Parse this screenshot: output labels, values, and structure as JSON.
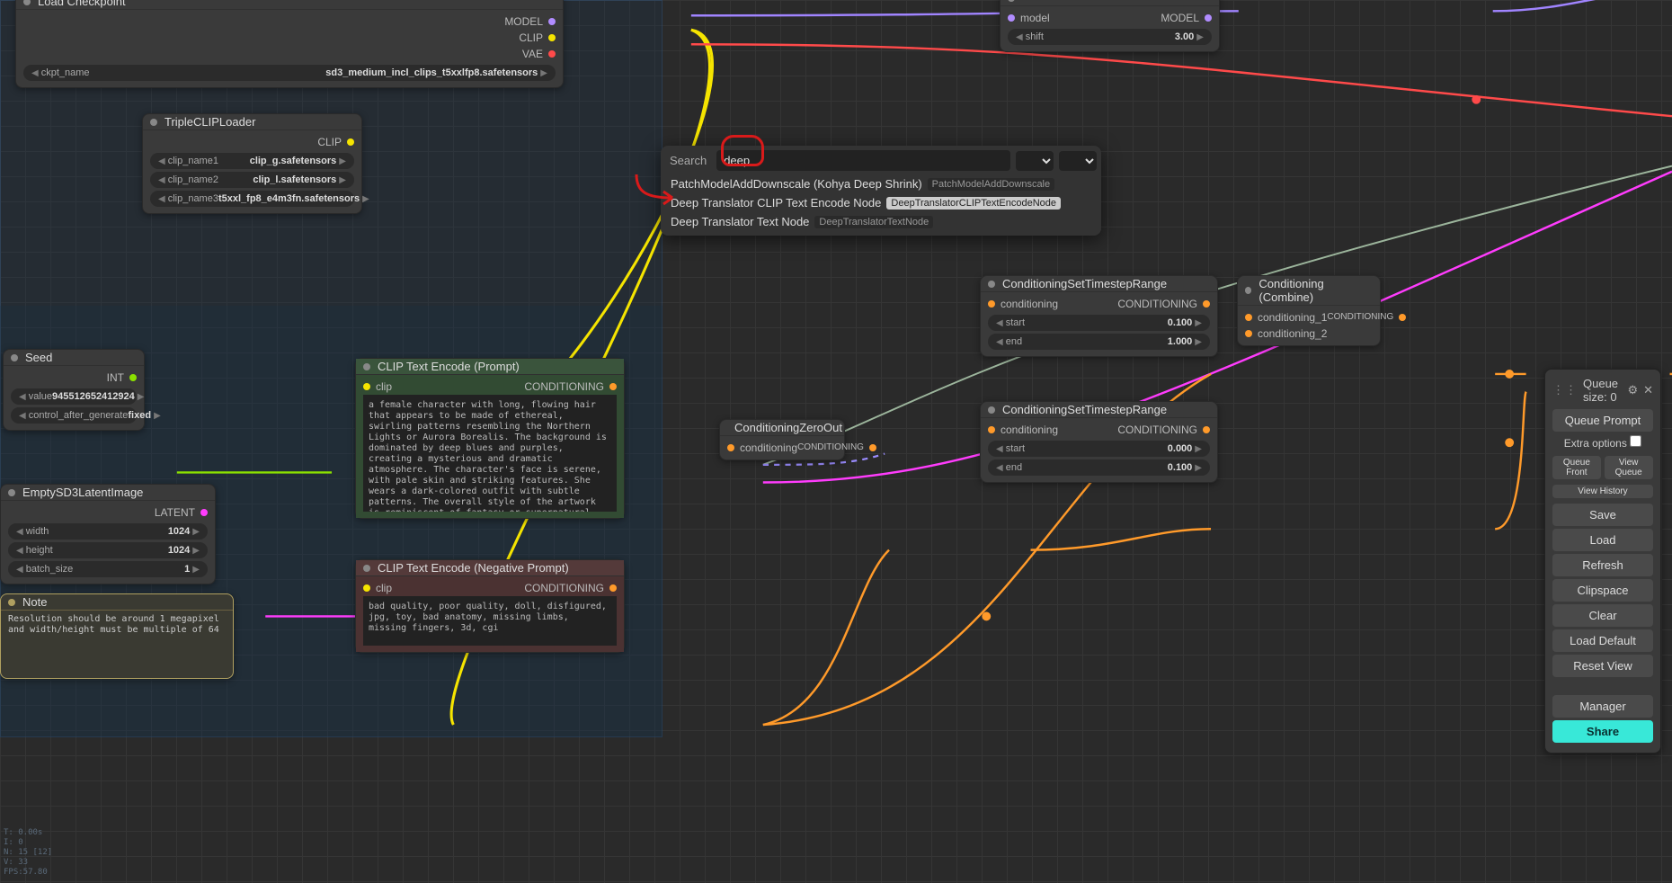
{
  "nodes": {
    "loadckpt": {
      "title": "Load Checkpoint",
      "outputs": [
        "MODEL",
        "CLIP",
        "VAE"
      ],
      "ckpt_label": "ckpt_name",
      "ckpt_value": "sd3_medium_incl_clips_t5xxlfp8.safetensors"
    },
    "tripleclip": {
      "title": "TripleCLIPLoader",
      "out": "CLIP",
      "rows": [
        {
          "label": "clip_name1",
          "value": "clip_g.safetensors"
        },
        {
          "label": "clip_name2",
          "value": "clip_l.safetensors"
        },
        {
          "label": "clip_name3",
          "value": "t5xxl_fp8_e4m3fn.safetensors"
        }
      ]
    },
    "seed": {
      "title": "Seed",
      "out": "INT",
      "rows": [
        {
          "label": "value",
          "value": "945512652412924"
        },
        {
          "label": "control_after_generate",
          "value": "fixed"
        }
      ]
    },
    "emptylatent": {
      "title": "EmptySD3LatentImage",
      "out": "LATENT",
      "rows": [
        {
          "label": "width",
          "value": "1024"
        },
        {
          "label": "height",
          "value": "1024"
        },
        {
          "label": "batch_size",
          "value": "1"
        }
      ]
    },
    "note": {
      "title": "Note",
      "text": "Resolution should be around 1 megapixel and width/height must be multiple of 64"
    },
    "clip_pos": {
      "title": "CLIP Text Encode (Prompt)",
      "in": "clip",
      "out": "CONDITIONING",
      "text": "a female character with long, flowing hair that appears to be made of ethereal, swirling patterns resembling the Northern Lights or Aurora Borealis. The background is dominated by deep blues and purples, creating a mysterious and dramatic atmosphere. The character's face is serene, with pale skin and striking features. She wears a dark-colored outfit with subtle patterns. The overall style of the artwork is reminiscent of fantasy or supernatural genres"
    },
    "clip_neg": {
      "title": "CLIP Text Encode (Negative Prompt)",
      "in": "clip",
      "out": "CONDITIONING",
      "text": "bad quality, poor quality, doll, disfigured, jpg, toy, bad anatomy, missing limbs, missing fingers, 3d, cgi"
    },
    "condzero": {
      "title": "ConditioningZeroOut",
      "in": "conditioning",
      "out": "CONDITIONING"
    },
    "tsrange1": {
      "title": "ConditioningSetTimestepRange",
      "in": "conditioning",
      "out": "CONDITIONING",
      "rows": [
        {
          "label": "start",
          "value": "0.100"
        },
        {
          "label": "end",
          "value": "1.000"
        }
      ]
    },
    "tsrange2": {
      "title": "ConditioningSetTimestepRange",
      "in": "conditioning",
      "out": "CONDITIONING",
      "rows": [
        {
          "label": "start",
          "value": "0.000"
        },
        {
          "label": "end",
          "value": "0.100"
        }
      ]
    },
    "combine": {
      "title": "Conditioning (Combine)",
      "ins": [
        "conditioning_1",
        "conditioning_2"
      ],
      "out": "CONDITIONING"
    },
    "modelsampling": {
      "in": "model",
      "out": "MODEL",
      "rows": [
        {
          "label": "shift",
          "value": "3.00"
        }
      ]
    }
  },
  "search": {
    "label": "Search",
    "query": "deep",
    "results": [
      {
        "name": "PatchModelAddDownscale (Kohya Deep Shrink)",
        "id": "PatchModelAddDownscale"
      },
      {
        "name": "Deep Translator CLIP Text Encode Node",
        "id": "DeepTranslatorCLIPTextEncodeNode",
        "selected": true
      },
      {
        "name": "Deep Translator Text Node",
        "id": "DeepTranslatorTextNode"
      }
    ]
  },
  "sidepanel": {
    "queue_label": "Queue size:",
    "queue_size": "0",
    "queue_prompt": "Queue Prompt",
    "extra_options": "Extra options",
    "queue_front": "Queue Front",
    "view_queue": "View Queue",
    "view_history": "View History",
    "save": "Save",
    "load": "Load",
    "refresh": "Refresh",
    "clipspace": "Clipspace",
    "clear": "Clear",
    "load_default": "Load Default",
    "reset_view": "Reset View",
    "manager": "Manager",
    "share": "Share"
  },
  "stats": "T: 0.00s\nI: 0\nN: 15 [12]\nV: 33\nFPS:57.80"
}
